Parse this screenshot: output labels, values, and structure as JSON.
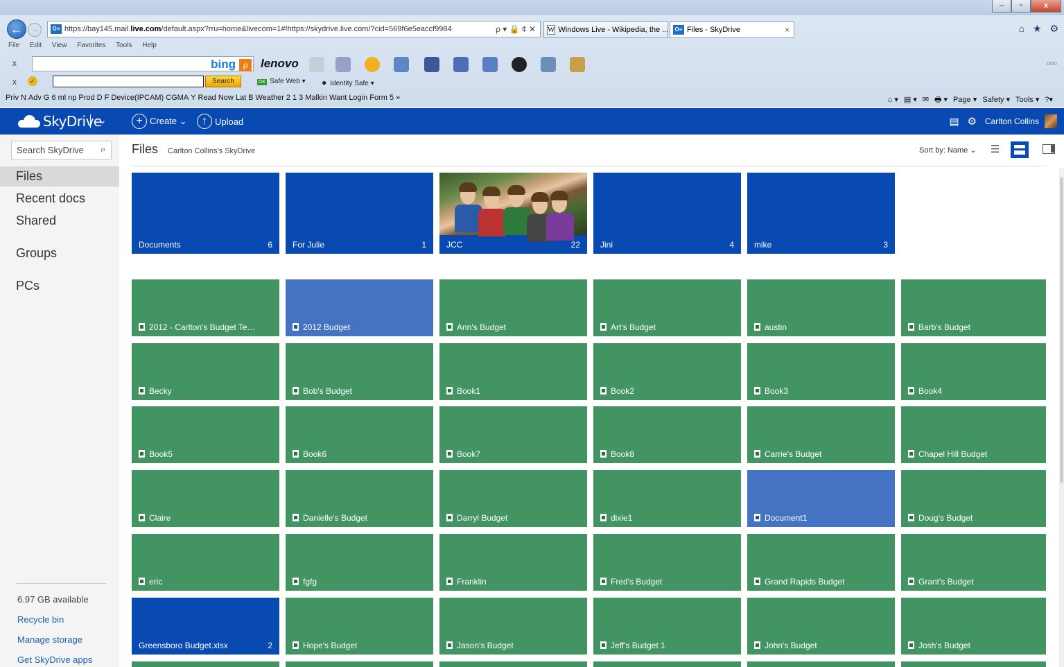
{
  "browser": {
    "window_controls": {
      "minimize": "–",
      "maximize": "▫",
      "close": "x"
    },
    "address_url_prefix": "https://bay145.mail.",
    "address_url_domain": "live.com",
    "address_url_rest": "/default.aspx?rru=home&livecom=1#!https://skydrive.live.com/?cid=569f6e5eaccf9984",
    "address_tools": "ρ ▾ 🔒 ¢ ✕",
    "favicon_text": "O≡",
    "tabs": [
      {
        "title": "Windows Live - Wikipedia, the ...",
        "icon": "W"
      },
      {
        "title": "Files - SkyDrive",
        "icon": "O≡"
      }
    ],
    "tab_close": "×",
    "nav_icons": "⌂ ★ ⚙",
    "menu": [
      "File",
      "Edit",
      "View",
      "Favorites",
      "Tools",
      "Help"
    ],
    "bing_bar": {
      "close": "x",
      "logo": "bing",
      "search_glyph": "ρ",
      "lenovo": "lenovo",
      "more": "ooo"
    },
    "search_toolbar": {
      "close": "x",
      "check": "✓",
      "search_label": "Search",
      "safe_web": "Safe Web ▾",
      "identity_safe": "Identity Safe ▾"
    },
    "favorites": [
      "Priv",
      "N",
      "Adv",
      "G",
      "6",
      "ml",
      "np",
      "Prod",
      "D",
      "F",
      "Device(IPCAM)",
      "CGMA",
      "Y",
      "Read Now",
      "Lat",
      "B",
      "Weather",
      "2",
      "1",
      "3",
      "Malkin",
      "Want",
      "Login Form",
      "5"
    ],
    "favorites_overflow": "»",
    "command_bar": [
      "⌂ ▾",
      "▤ ▾",
      "✉",
      "🖶 ▾",
      "Page ▾",
      "Safety ▾",
      "Tools ▾",
      "?▾"
    ]
  },
  "header": {
    "logo_text": "SkyDrive",
    "menu_chevron": "⌄",
    "create_label": "Create ⌄",
    "upload_label": "Upload",
    "create_glyph": "+",
    "upload_glyph": "↑",
    "messages_glyph": "▤",
    "settings_glyph": "⚙",
    "user_name": "Carlton Collins"
  },
  "left_pane": {
    "search_placeholder": "Search SkyDrive",
    "search_glyph": "⌕",
    "nav": [
      {
        "label": "Files",
        "selected": true
      },
      {
        "label": "Recent docs",
        "selected": false
      },
      {
        "label": "Shared",
        "selected": false
      },
      {
        "label": "Groups",
        "selected": false
      },
      {
        "label": "PCs",
        "selected": false
      }
    ],
    "storage": "6.97 GB available",
    "links": [
      "Recycle bin",
      "Manage storage",
      "Get SkyDrive apps"
    ]
  },
  "main": {
    "title": "Files",
    "owner": "Carlton Collins's SkyDrive",
    "sort_label": "Sort by: Name ⌄",
    "view_list_glyph": "☰"
  },
  "folders": [
    {
      "name": "Documents",
      "count": "6"
    },
    {
      "name": "For Julie",
      "count": "1"
    },
    {
      "name": "JCC",
      "count": "22",
      "has_photo": true
    },
    {
      "name": "Jini",
      "count": "4"
    },
    {
      "name": "mike",
      "count": "3"
    }
  ],
  "files": [
    {
      "name": "2012 - Carlton's Budget Tem...",
      "kind": "excel"
    },
    {
      "name": "2012 Budget",
      "kind": "word"
    },
    {
      "name": "Ann's Budget",
      "kind": "excel"
    },
    {
      "name": "Art's Budget",
      "kind": "excel"
    },
    {
      "name": "austin",
      "kind": "excel"
    },
    {
      "name": "Barb's Budget",
      "kind": "excel"
    },
    {
      "name": "Becky",
      "kind": "excel"
    },
    {
      "name": "Bob's Budget",
      "kind": "excel"
    },
    {
      "name": "Book1",
      "kind": "excel"
    },
    {
      "name": "Book2",
      "kind": "excel"
    },
    {
      "name": "Book3",
      "kind": "excel"
    },
    {
      "name": "Book4",
      "kind": "excel"
    },
    {
      "name": "Book5",
      "kind": "excel"
    },
    {
      "name": "Book6",
      "kind": "excel"
    },
    {
      "name": "Book7",
      "kind": "excel"
    },
    {
      "name": "Book8",
      "kind": "excel"
    },
    {
      "name": "Carrie's Budget",
      "kind": "excel"
    },
    {
      "name": "Chapel Hill Budget",
      "kind": "excel"
    },
    {
      "name": "Claire",
      "kind": "excel"
    },
    {
      "name": "Danielle's Budget",
      "kind": "excel"
    },
    {
      "name": "Darryl Budget",
      "kind": "excel"
    },
    {
      "name": "dixie1",
      "kind": "excel"
    },
    {
      "name": "Document1",
      "kind": "word"
    },
    {
      "name": "Doug's Budget",
      "kind": "excel"
    },
    {
      "name": "eric",
      "kind": "excel"
    },
    {
      "name": "fgfg",
      "kind": "excel"
    },
    {
      "name": "Franklin",
      "kind": "excel"
    },
    {
      "name": "Fred's Budget",
      "kind": "excel"
    },
    {
      "name": "Grand Rapids Budget",
      "kind": "excel"
    },
    {
      "name": "Grant's Budget",
      "kind": "excel"
    },
    {
      "name": "Greensboro Budget.xlsx",
      "kind": "folder",
      "count": "2"
    },
    {
      "name": "Hope's Budget",
      "kind": "excel"
    },
    {
      "name": "Jason's Budget",
      "kind": "excel"
    },
    {
      "name": "Jeff's Budget 1",
      "kind": "excel"
    },
    {
      "name": "John's Budget",
      "kind": "excel"
    },
    {
      "name": "Josh's Budget",
      "kind": "excel"
    }
  ],
  "colors": {
    "brand_blue": "#094ab2",
    "excel_green": "#429463",
    "word_blue": "#4573c4",
    "link_blue": "#1a5fb4"
  }
}
